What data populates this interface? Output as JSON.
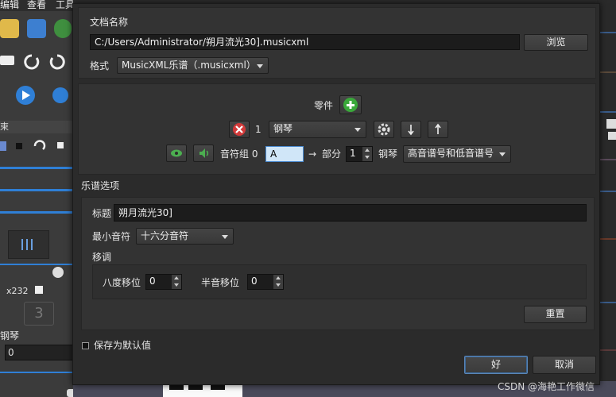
{
  "background": {
    "menu": [
      "编辑",
      "查看",
      "工具"
    ],
    "panel_header": "束",
    "spin_value": "x232",
    "instrument": "钢琴",
    "zero_value": "0"
  },
  "dialog": {
    "doc_name_label": "文档名称",
    "doc_path": "C:/Users/Administrator/朔月流光30].musicxml",
    "browse_label": "浏览",
    "format_label": "格式",
    "format_value": "MusicXML乐谱（.musicxml）",
    "parts": {
      "label": "零件",
      "part_number": "1",
      "instrument": "钢琴",
      "voice_group_label": "音符组 0",
      "voice_value": "A",
      "arrow": "→",
      "part_label": "部分",
      "part_value": "1",
      "part_instrument": "钢琴",
      "clef_value": "高音谱号和低音谱号"
    },
    "score_options": {
      "title": "乐谱选项",
      "title_label": "标题",
      "title_value": "朔月流光30]",
      "min_note_label": "最小音符",
      "min_note_value": "十六分音符",
      "transpose_label": "移调",
      "octave_label": "八度移位",
      "octave_value": "0",
      "semitone_label": "半音移位",
      "semitone_value": "0",
      "reset_label": "重置"
    },
    "save_default_label": "保存为默认值",
    "ok_label": "好",
    "cancel_label": "取消"
  },
  "watermark": "CSDN @海艳工作微信",
  "colors": {
    "accent_blue": "#2f7fd6",
    "green_add": "#3aa83a",
    "red_remove": "#d23a3a",
    "dialog_bg": "#2b2b2b"
  },
  "icons": [
    "save-icon",
    "export-icon",
    "print-icon",
    "undo-icon",
    "redo-icon",
    "play-icon",
    "add-icon",
    "remove-icon",
    "gear-icon",
    "arrow-down-icon",
    "arrow-up-icon",
    "eye-icon",
    "speaker-icon",
    "chevron-down-icon"
  ]
}
